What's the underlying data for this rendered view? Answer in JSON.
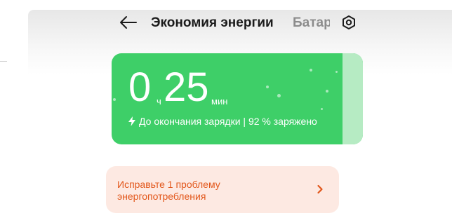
{
  "header": {
    "back_icon": "arrow-left-icon",
    "title": "Экономия энергии",
    "next_tab_partial": "Батар",
    "settings_icon": "gear-hexagon-icon"
  },
  "battery": {
    "hours": "0",
    "hours_unit": "ч",
    "minutes": "25",
    "minutes_unit": "мин",
    "status_icon": "lightning-icon",
    "status_text": "До окончания зарядки | 92 % заряжено",
    "charge_fraction": 0.92,
    "fill_color": "#3ecf68",
    "remaining_color": "#b6ebc3"
  },
  "issue": {
    "text_line1": "Исправьте 1 проблему",
    "text_line2": "энергопотребления",
    "chevron_icon": "chevron-right-icon",
    "text_color": "#e2571b",
    "background": "#fde9e2"
  }
}
